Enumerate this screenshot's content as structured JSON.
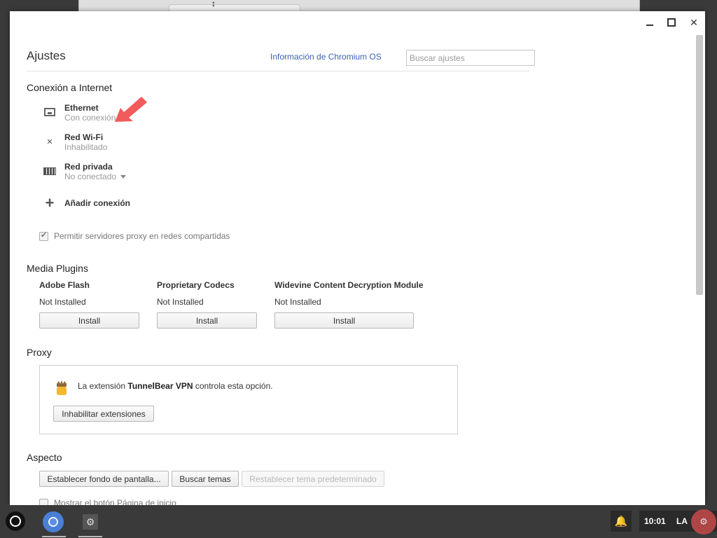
{
  "window": {
    "title": "Ajustes",
    "about_link": "Información de Chromium OS",
    "search_placeholder": "Buscar ajustes",
    "controls": {
      "minimize": "minimize-icon",
      "maximize": "maximize-icon",
      "close": "close-icon"
    }
  },
  "internet": {
    "heading": "Conexión a Internet",
    "networks": [
      {
        "name": "Ethernet",
        "status": "Con conexión",
        "icon": "ethernet-icon"
      },
      {
        "name": "Red Wi-Fi",
        "status": "Inhabilitado",
        "icon": "wifi-disabled-icon"
      },
      {
        "name": "Red privada",
        "status": "No conectado",
        "icon": "vpn-icon"
      }
    ],
    "add_connection": "Añadir conexión",
    "proxy_checkbox": {
      "label": "Permitir servidores proxy en redes compartidas",
      "checked": true
    }
  },
  "media_plugins": {
    "heading": "Media Plugins",
    "plugins": [
      {
        "name": "Adobe Flash",
        "status": "Not Installed",
        "button": "Install"
      },
      {
        "name": "Proprietary Codecs",
        "status": "Not Installed",
        "button": "Install"
      },
      {
        "name": "Widevine Content Decryption Module",
        "status": "Not Installed",
        "button": "Install"
      }
    ]
  },
  "proxy": {
    "heading": "Proxy",
    "text_prefix": "La extensión ",
    "extension_name": "TunnelBear VPN",
    "text_suffix": " controla esta opción.",
    "disable_button": "Inhabilitar extensiones"
  },
  "appearance": {
    "heading": "Aspecto",
    "buttons": [
      "Establecer fondo de pantalla...",
      "Buscar temas",
      "Restablecer tema predeterminado"
    ],
    "home_checkbox": {
      "label": "Mostrar el botón Página de inicio",
      "checked": false
    }
  },
  "shelf": {
    "time": "10:01",
    "language": "LA",
    "apps": [
      "launcher-icon",
      "chromium-icon",
      "settings-gear-icon"
    ],
    "notification_icon": "bell-icon"
  },
  "colors": {
    "link": "#3b60b8",
    "annotation_arrow": "#f25b5b",
    "window_bg": "#ffffff",
    "desktop_bg": "#3a3a3a"
  }
}
